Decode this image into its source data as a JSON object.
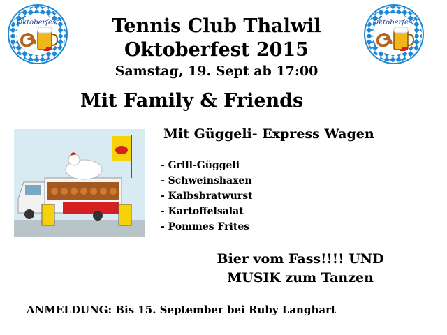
{
  "header": {
    "line1": "Tennis Club Thalwil",
    "line2": "Oktoberfest 2015",
    "line3": "Samstag, 19. Sept ab 17:00"
  },
  "logo": {
    "text": "Oktoberfest"
  },
  "subtitle": "Mit Family & Friends",
  "wagon_heading": "Mit Güggeli- Express Wagen",
  "menu": [
    "- Grill-Güggeli",
    "- Schweinshaxen",
    "- Kalbsbratwurst",
    "- Kartoffelsalat",
    "- Pommes Frites"
  ],
  "drinks": {
    "line1": "Bier vom Fass!!!! UND",
    "line2": "MUSIK zum Tanzen"
  },
  "registration": "ANMELDUNG: Bis 15. September bei Ruby Langhart",
  "colors": {
    "bavarian_blue": "#1e88d6",
    "truck_red": "#d42020",
    "flag_yellow": "#f7d20a"
  }
}
